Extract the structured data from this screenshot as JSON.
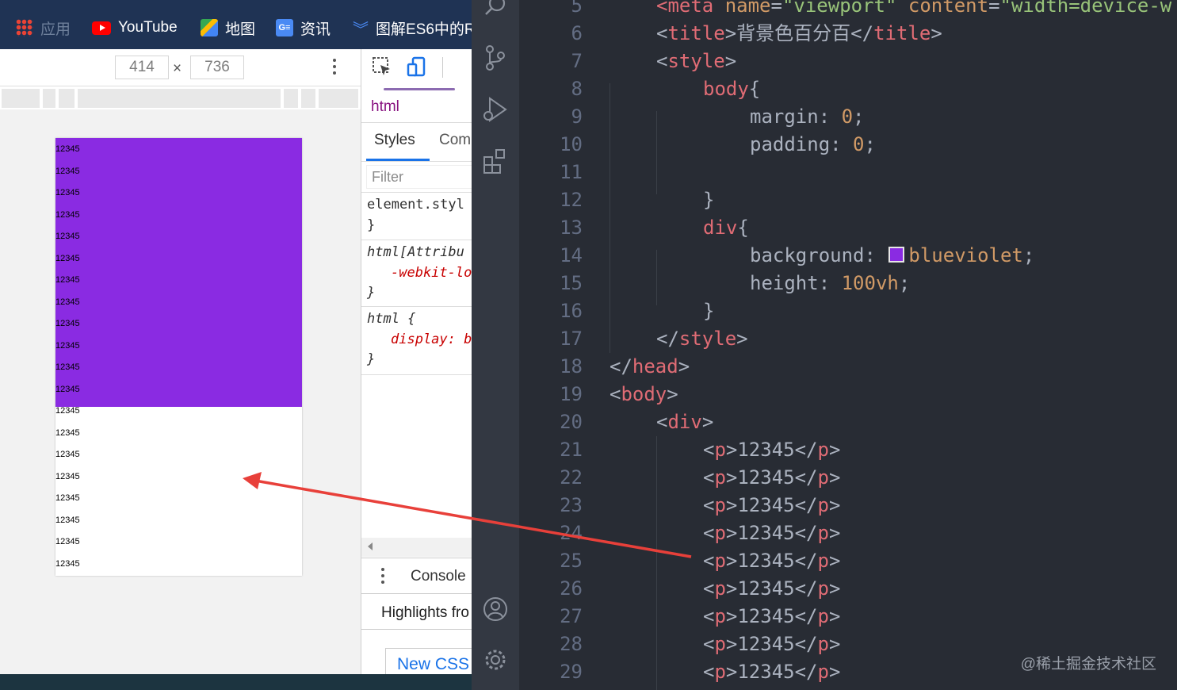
{
  "bookmarks": [
    {
      "label": "应用",
      "icon": "apps-grid-icon"
    },
    {
      "label": "YouTube",
      "icon": "youtube-icon"
    },
    {
      "label": "地图",
      "icon": "maps-icon"
    },
    {
      "label": "资讯",
      "icon": "news-icon"
    },
    {
      "label": "图解ES6中的R",
      "icon": "bookmark-chevron-icon"
    }
  ],
  "device_toolbar": {
    "width": "414",
    "times": "×",
    "height": "736"
  },
  "page": {
    "lines": [
      "12345",
      "12345",
      "12345",
      "12345",
      "12345",
      "12345",
      "12345",
      "12345",
      "12345",
      "12345",
      "12345",
      "12345",
      "12345",
      "12345",
      "12345",
      "12345",
      "12345",
      "12345",
      "12345",
      "12345"
    ],
    "purple_lines": 12,
    "purple_color": "#8a2be2"
  },
  "devtools": {
    "breadcrumb": "html",
    "tabs": {
      "styles": "Styles",
      "computed": "Com"
    },
    "filter_placeholder": "Filter",
    "rules": [
      {
        "selector": "element.styl",
        "close": "}"
      },
      {
        "selector": "html[Attribu",
        "decl": "-webkit-lo",
        "close": "}"
      },
      {
        "selector": "html {",
        "decl": "display: b",
        "close": "}"
      }
    ],
    "drawer": {
      "console": "Console",
      "highlights": "Highlights fro",
      "new_css": "New CSS"
    }
  },
  "editor": {
    "lines": [
      {
        "n": "5",
        "indent": 1,
        "parts": [
          [
            "tag",
            "<meta "
          ],
          [
            "attr",
            "name"
          ],
          [
            "prop",
            "="
          ],
          [
            "str",
            "\"viewport\""
          ],
          [
            "prop",
            " "
          ],
          [
            "attr",
            "content"
          ],
          [
            "prop",
            "="
          ],
          [
            "str",
            "\"width=device-w"
          ]
        ]
      },
      {
        "n": "6",
        "indent": 1,
        "parts": [
          [
            "prop",
            "<"
          ],
          [
            "tag",
            "title"
          ],
          [
            "prop",
            ">背景色百分百</"
          ],
          [
            "tag",
            "title"
          ],
          [
            "prop",
            ">"
          ]
        ]
      },
      {
        "n": "7",
        "indent": 1,
        "parts": [
          [
            "prop",
            "<"
          ],
          [
            "tag",
            "style"
          ],
          [
            "prop",
            ">"
          ]
        ]
      },
      {
        "n": "8",
        "indent": 2,
        "parts": [
          [
            "tag",
            "body"
          ],
          [
            "prop",
            "{"
          ]
        ]
      },
      {
        "n": "9",
        "indent": 3,
        "parts": [
          [
            "prop",
            "margin: "
          ],
          [
            "num",
            "0"
          ],
          [
            "prop",
            ";"
          ]
        ]
      },
      {
        "n": "10",
        "indent": 3,
        "parts": [
          [
            "prop",
            "padding: "
          ],
          [
            "num",
            "0"
          ],
          [
            "prop",
            ";"
          ]
        ]
      },
      {
        "n": "11",
        "indent": 0,
        "parts": []
      },
      {
        "n": "12",
        "indent": 2,
        "parts": [
          [
            "prop",
            "}"
          ]
        ]
      },
      {
        "n": "13",
        "indent": 2,
        "parts": [
          [
            "tag",
            "div"
          ],
          [
            "prop",
            "{"
          ]
        ]
      },
      {
        "n": "14",
        "indent": 3,
        "parts": [
          [
            "prop",
            "background: "
          ],
          [
            "swatch",
            "#8a2be2"
          ],
          [
            "val",
            "blueviolet"
          ],
          [
            "prop",
            ";"
          ]
        ]
      },
      {
        "n": "15",
        "indent": 3,
        "parts": [
          [
            "prop",
            "height: "
          ],
          [
            "num",
            "100vh"
          ],
          [
            "prop",
            ";"
          ]
        ]
      },
      {
        "n": "16",
        "indent": 2,
        "parts": [
          [
            "prop",
            "}"
          ]
        ]
      },
      {
        "n": "17",
        "indent": 1,
        "parts": [
          [
            "prop",
            "</"
          ],
          [
            "tag",
            "style"
          ],
          [
            "prop",
            ">"
          ]
        ]
      },
      {
        "n": "18",
        "indent": 0,
        "parts": [
          [
            "prop",
            "</"
          ],
          [
            "tag",
            "head"
          ],
          [
            "prop",
            ">"
          ]
        ]
      },
      {
        "n": "19",
        "indent": 0,
        "parts": [
          [
            "prop",
            "<"
          ],
          [
            "tag",
            "body"
          ],
          [
            "prop",
            ">"
          ]
        ]
      },
      {
        "n": "20",
        "indent": 1,
        "parts": [
          [
            "prop",
            "<"
          ],
          [
            "tag",
            "div"
          ],
          [
            "prop",
            ">"
          ]
        ]
      },
      {
        "n": "21",
        "indent": 2,
        "parts": [
          [
            "prop",
            "<"
          ],
          [
            "tag",
            "p"
          ],
          [
            "prop",
            ">12345</"
          ],
          [
            "tag",
            "p"
          ],
          [
            "prop",
            ">"
          ]
        ]
      },
      {
        "n": "22",
        "indent": 2,
        "parts": [
          [
            "prop",
            "<"
          ],
          [
            "tag",
            "p"
          ],
          [
            "prop",
            ">12345</"
          ],
          [
            "tag",
            "p"
          ],
          [
            "prop",
            ">"
          ]
        ]
      },
      {
        "n": "23",
        "indent": 2,
        "parts": [
          [
            "prop",
            "<"
          ],
          [
            "tag",
            "p"
          ],
          [
            "prop",
            ">12345</"
          ],
          [
            "tag",
            "p"
          ],
          [
            "prop",
            ">"
          ]
        ]
      },
      {
        "n": "24",
        "indent": 2,
        "parts": [
          [
            "prop",
            "<"
          ],
          [
            "tag",
            "p"
          ],
          [
            "prop",
            ">12345</"
          ],
          [
            "tag",
            "p"
          ],
          [
            "prop",
            ">"
          ]
        ]
      },
      {
        "n": "25",
        "indent": 2,
        "parts": [
          [
            "prop",
            "<"
          ],
          [
            "tag",
            "p"
          ],
          [
            "prop",
            ">12345</"
          ],
          [
            "tag",
            "p"
          ],
          [
            "prop",
            ">"
          ]
        ]
      },
      {
        "n": "26",
        "indent": 2,
        "parts": [
          [
            "prop",
            "<"
          ],
          [
            "tag",
            "p"
          ],
          [
            "prop",
            ">12345</"
          ],
          [
            "tag",
            "p"
          ],
          [
            "prop",
            ">"
          ]
        ]
      },
      {
        "n": "27",
        "indent": 2,
        "parts": [
          [
            "prop",
            "<"
          ],
          [
            "tag",
            "p"
          ],
          [
            "prop",
            ">12345</"
          ],
          [
            "tag",
            "p"
          ],
          [
            "prop",
            ">"
          ]
        ]
      },
      {
        "n": "28",
        "indent": 2,
        "parts": [
          [
            "prop",
            "<"
          ],
          [
            "tag",
            "p"
          ],
          [
            "prop",
            ">12345</"
          ],
          [
            "tag",
            "p"
          ],
          [
            "prop",
            ">"
          ]
        ]
      },
      {
        "n": "29",
        "indent": 2,
        "parts": [
          [
            "prop",
            "<"
          ],
          [
            "tag",
            "p"
          ],
          [
            "prop",
            ">12345</"
          ],
          [
            "tag",
            "p"
          ],
          [
            "prop",
            ">"
          ]
        ]
      }
    ],
    "watermark": "@稀土掘金技术社区"
  },
  "activity_bar": [
    "search-icon",
    "source-control-icon",
    "run-debug-icon",
    "extensions-icon",
    "account-icon",
    "settings-gear-icon"
  ],
  "colors": {
    "arrow": "#e8403a",
    "purple": "#8a2be2",
    "editor_bg": "#282c34"
  }
}
